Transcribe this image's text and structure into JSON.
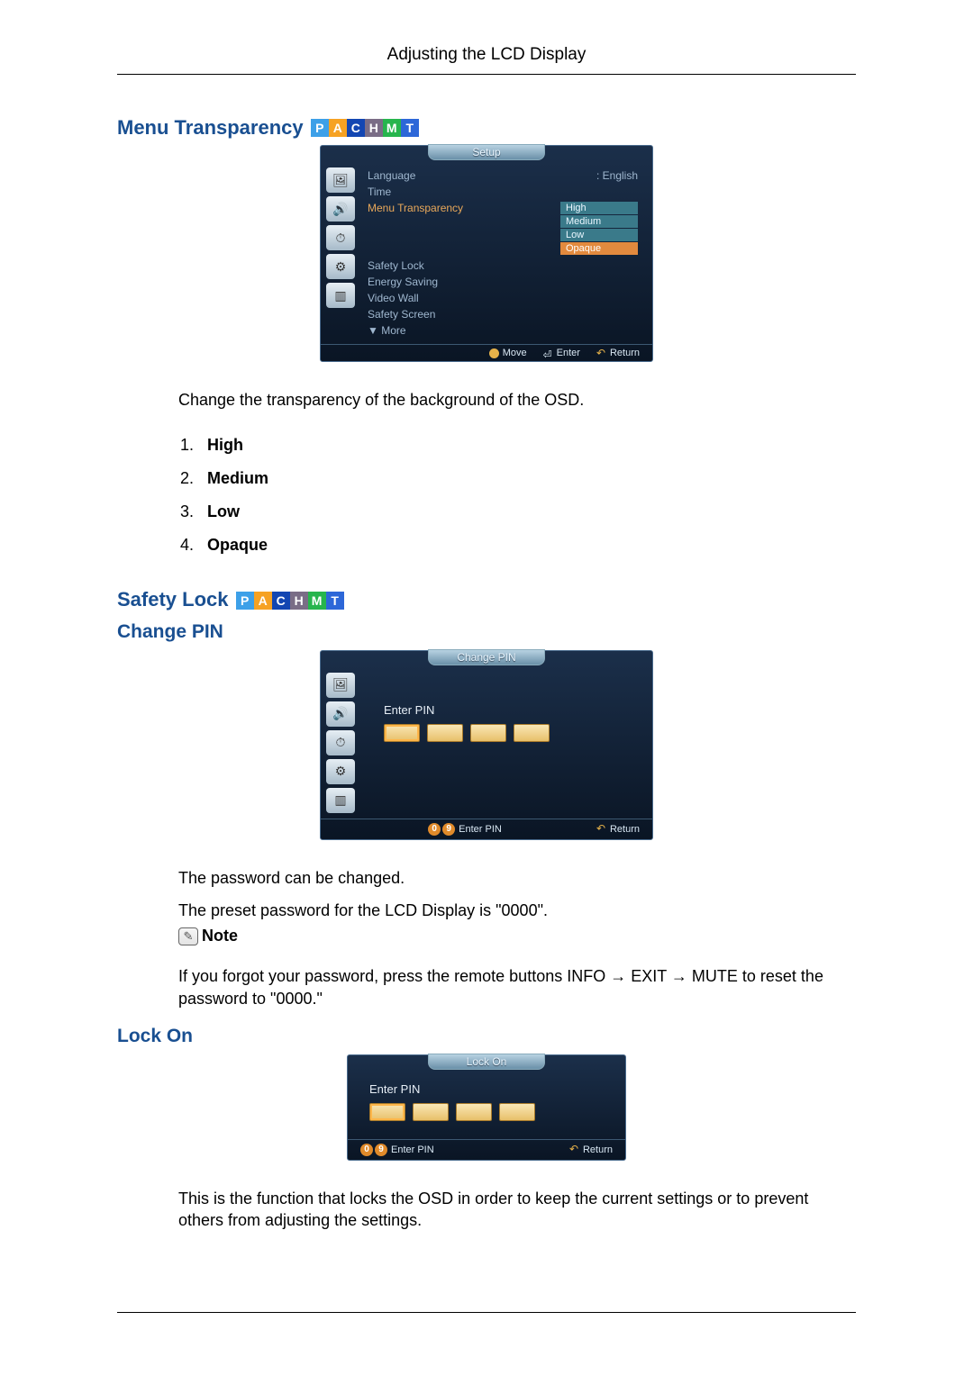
{
  "header": {
    "title": "Adjusting the LCD Display"
  },
  "pachmt": {
    "p": "P",
    "a": "A",
    "c": "C",
    "h": "H",
    "m": "M",
    "t": "T"
  },
  "section1": {
    "title": "Menu Transparency",
    "osd": {
      "tab": "Setup",
      "rows": {
        "language_lbl": "Language",
        "language_val": ": English",
        "time_lbl": "Time",
        "menu_trans_lbl": "Menu Transparency",
        "safety_lock_lbl": "Safety Lock",
        "energy_lbl": "Energy Saving",
        "video_wall_lbl": "Video Wall",
        "safety_screen_lbl": "Safety Screen",
        "more_lbl": "▼ More"
      },
      "trans_options": {
        "high": "High",
        "medium": "Medium",
        "low": "Low",
        "opaque": "Opaque"
      },
      "footer": {
        "move": "Move",
        "enter": "Enter",
        "return": "Return"
      }
    },
    "desc": "Change the transparency of the background of the OSD.",
    "list": {
      "i1": "High",
      "i2": "Medium",
      "i3": "Low",
      "i4": "Opaque"
    }
  },
  "section2": {
    "title": "Safety Lock",
    "changepin_title": "Change PIN",
    "osd": {
      "tab": "Change PIN",
      "enter_pin": "Enter PIN",
      "footer": {
        "enterpin": "Enter PIN",
        "return": "Return",
        "num0": "0",
        "num9": "9"
      }
    },
    "para1": "The password can be changed.",
    "para2": "The preset password for the LCD Display is \"0000\".",
    "note_label": "Note",
    "para3": "If you forgot your password, press the remote buttons INFO  → EXIT → MUTE to reset the password to \"0000.\""
  },
  "section3": {
    "title": "Lock On",
    "osd": {
      "tab": "Lock On",
      "enter_pin": "Enter PIN",
      "footer": {
        "enterpin": "Enter PIN",
        "return": "Return",
        "num0": "0",
        "num9": "9"
      }
    },
    "para": "This is the function that locks the OSD in order to keep the current settings or to prevent others from adjusting the settings."
  }
}
